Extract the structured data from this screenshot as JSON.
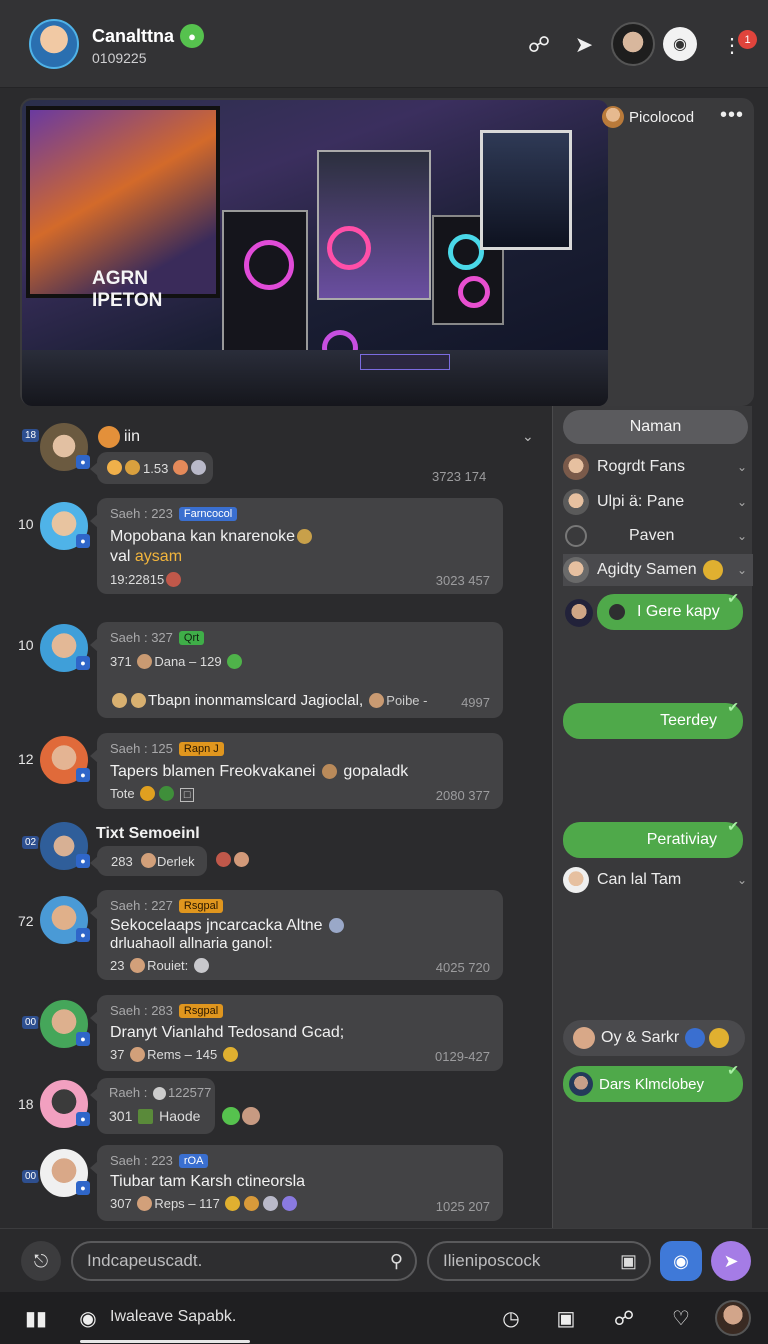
{
  "header": {
    "title": "Canalttna",
    "subtitle": "0109225",
    "badge_count": "1"
  },
  "media": {
    "poster_text": "AGRN IPETON",
    "side_name": "Picolocod"
  },
  "messages": [
    {
      "num": "18",
      "meta": "iin",
      "line1": "1.53",
      "stamp": "3723 174"
    },
    {
      "num": "10",
      "meta": "Saeh : 223",
      "tag": "Farncocol",
      "line1": "Mopobana kan knarenoke",
      "line2": "val",
      "line2_hl": "aysam",
      "footer": "19:22815",
      "stamp": "3023 457"
    },
    {
      "num": "10",
      "meta": "Saeh : 327",
      "tag": "Qrt",
      "line1": "371",
      "line1b": "Dana – 129",
      "line2": "Tbapn inonmamslcard Jagioclal,",
      "line2b": "Poibe -",
      "stamp": "4997"
    },
    {
      "num": "12",
      "meta": "Saeh : 125",
      "tag": "Rapn J",
      "line1": "Tapers blamen Freokvakanei",
      "line1b": "gopaladk",
      "footer": "Tote",
      "stamp": "2080 377"
    },
    {
      "num": "02",
      "meta": "Tixt  Semoeinl",
      "line1": "283",
      "line1b": "Derlek"
    },
    {
      "num": "72",
      "meta": "Saeh : 227",
      "tag": "Rsgpal",
      "line1": "Sekocelaaps jncarcacka Altne",
      "line2": "drluahaoll allnaria ganol:",
      "footer": "23",
      "footer_b": "Rouiet:",
      "stamp": "4025 720"
    },
    {
      "num": "00",
      "meta": "Saeh : 283",
      "tag": "Rsgpal",
      "line1": "Dranyt Vianlahd Tedosand Gcad;",
      "footer": "37",
      "footer_b": "Rems – 145",
      "stamp": "0129-427"
    },
    {
      "num": "18",
      "meta": "Raeh :",
      "meta_b": "122577",
      "line1": "301",
      "line1b": "Haode"
    },
    {
      "num": "00",
      "meta": "Saeh : 223",
      "tag": "rOA",
      "line1": "Tiubar tam Karsh ctineorsla",
      "footer": "307",
      "footer_b": "Reps – 117",
      "stamp": "1025 207"
    }
  ],
  "right_panel": {
    "header": "Naman",
    "rows": [
      "Rogrdt Fans",
      "Ulpi ä: Pane",
      "Paven",
      "Agidty Samen"
    ],
    "pill1": "I Gere kapy",
    "pill2": "Teerdey",
    "pill3": "Perativiay",
    "row5": "Can lal Tam",
    "row6": "Oy & Sarkr",
    "pill4": "Dars Klmclobey"
  },
  "composer": {
    "input1_placeholder": "Indcapeuscadt.",
    "input2_placeholder": "Ilieniposcock"
  },
  "bottomnav": {
    "label": "Iwaleave Sapabk."
  },
  "colors": {
    "background": "#2b2b2d",
    "bubble": "#434345",
    "accent_green": "#4fa94a",
    "accent_blue": "#3a6fd0",
    "accent_purple": "#a57ce6",
    "badge_red": "#e0443c"
  }
}
